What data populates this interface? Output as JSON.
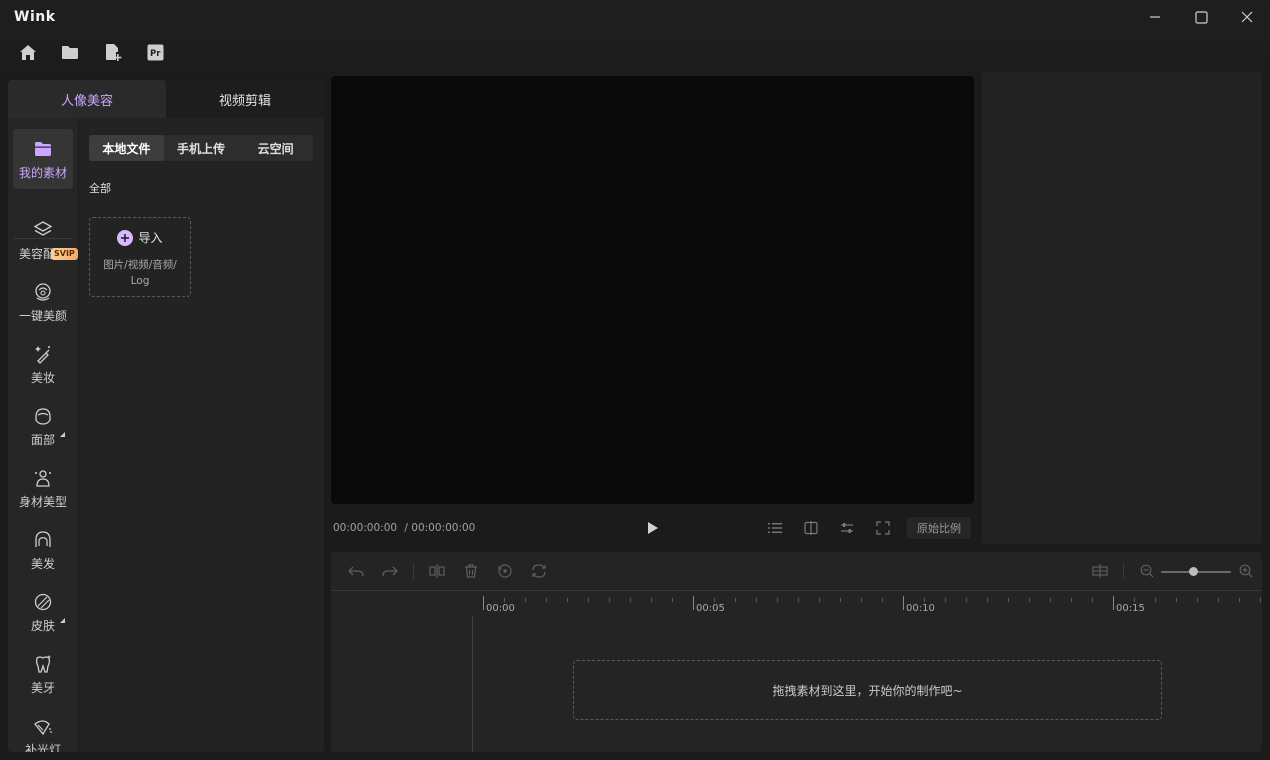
{
  "app": {
    "title": "Wink"
  },
  "left_panel": {
    "tabs": [
      {
        "label": "人像美容",
        "active": true
      },
      {
        "label": "视频剪辑",
        "active": false
      }
    ],
    "nav": [
      {
        "label": "我的素材",
        "icon": "folder-icon",
        "active": true
      },
      {
        "label": "美容配方",
        "icon": "layers-icon",
        "badge": "SVIP"
      },
      {
        "label": "一键美颜",
        "icon": "face-beauty-icon"
      },
      {
        "label": "美妆",
        "icon": "makeup-icon"
      },
      {
        "label": "面部",
        "icon": "face-icon"
      },
      {
        "label": "身材美型",
        "icon": "body-icon"
      },
      {
        "label": "美发",
        "icon": "hair-icon"
      },
      {
        "label": "皮肤",
        "icon": "skin-icon"
      },
      {
        "label": "美牙",
        "icon": "tooth-icon"
      },
      {
        "label": "补光灯",
        "icon": "fill-light-icon"
      }
    ],
    "source_tabs": [
      {
        "label": "本地文件",
        "active": true
      },
      {
        "label": "手机上传",
        "active": false
      },
      {
        "label": "云空间",
        "active": false
      }
    ],
    "filter_label": "全部",
    "import": {
      "label": "导入",
      "hint_line1": "图片/视频/音频/",
      "hint_line2": "Log"
    }
  },
  "preview": {
    "current_time": "00:00:00:00",
    "total_time": "/ 00:00:00:00",
    "ratio_label": "原始比例"
  },
  "timeline": {
    "ruler_labels": [
      "00:00",
      "00:05",
      "00:10",
      "00:15"
    ],
    "drop_hint": "拖拽素材到这里，开始你的制作吧~"
  },
  "colors": {
    "accent": "#c9a6ff",
    "background": "#1b1b1b",
    "panel": "#232323",
    "preview": "#0a0a0a"
  }
}
